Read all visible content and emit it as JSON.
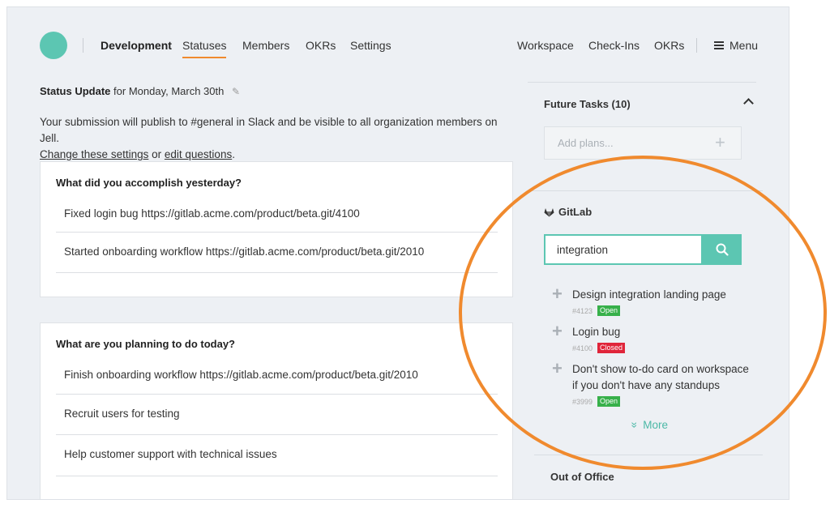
{
  "nav": {
    "team": "Development",
    "tabs": [
      "Statuses",
      "Members",
      "OKRs",
      "Settings"
    ],
    "right": [
      "Workspace",
      "Check-Ins",
      "OKRs"
    ],
    "menu": "Menu"
  },
  "status_update": {
    "title": "Status Update",
    "date_text": "for Monday, March 30th",
    "desc": "Your submission will publish to #general in Slack and be visible to all organization members on Jell.",
    "settings_link": "Change these settings",
    "or": "or",
    "edit_link": "edit questions",
    "period": "."
  },
  "questions": [
    {
      "q": "What did you accomplish yesterday?",
      "answers": [
        "Fixed login bug https://gitlab.acme.com/product/beta.git/4100",
        "Started onboarding workflow https://gitlab.acme.com/product/beta.git/2010"
      ]
    },
    {
      "q": "What are you planning to do today?",
      "answers": [
        "Finish onboarding workflow https://gitlab.acme.com/product/beta.git/2010",
        "Recruit users for testing",
        "Help customer support with technical issues"
      ]
    }
  ],
  "future_tasks": {
    "title": "Future Tasks (10)",
    "placeholder": "Add plans..."
  },
  "gitlab": {
    "title": "GitLab",
    "search_value": "integration",
    "results": [
      {
        "title": "Design integration landing page",
        "id": "#4123",
        "status": "Open"
      },
      {
        "title": "Login bug",
        "id": "#4100",
        "status": "Closed"
      },
      {
        "title": "Don't show to-do card on workspace if you don't have any standups",
        "id": "#3999",
        "status": "Open"
      }
    ],
    "more": "More"
  },
  "out_of_office": "Out of Office",
  "colors": {
    "accent": "#5cc6b2",
    "highlight": "#f08a2e",
    "open": "#37b04a",
    "closed": "#e0253a"
  }
}
